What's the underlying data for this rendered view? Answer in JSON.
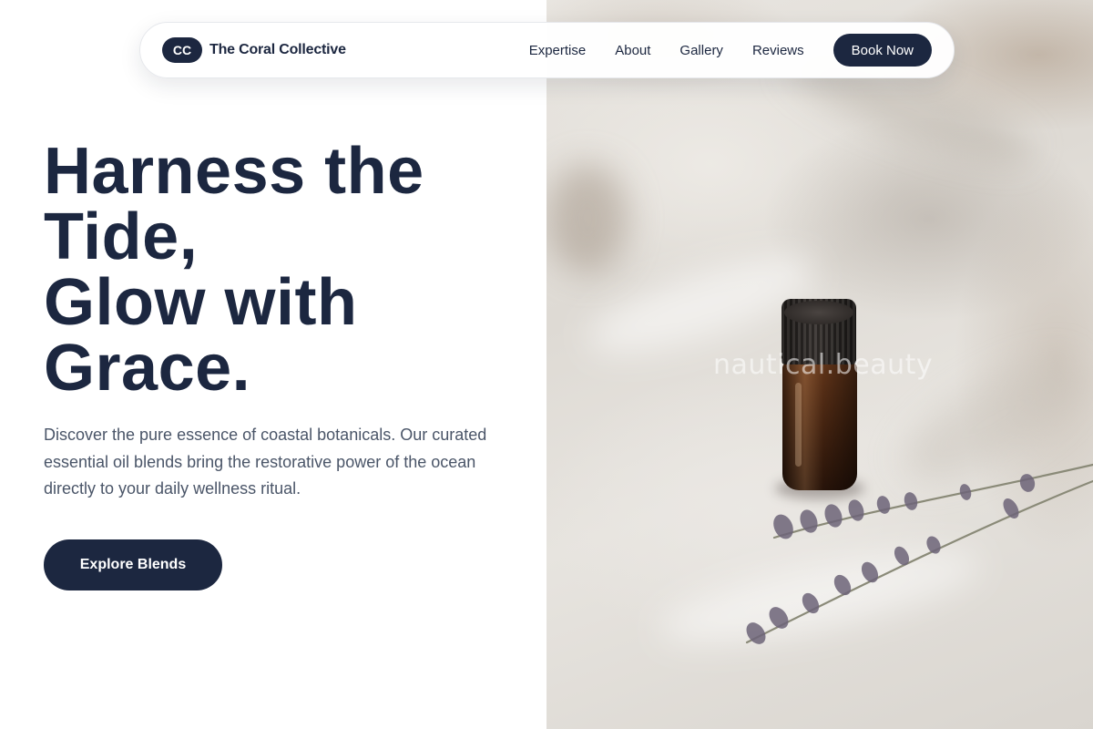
{
  "brand": {
    "badge": "CC",
    "name": "The Coral Collective"
  },
  "nav": {
    "links": [
      "Expertise",
      "About",
      "Gallery",
      "Reviews"
    ],
    "cta_label": "Book Now"
  },
  "hero": {
    "title_lines": [
      "Harness the",
      "Tide,",
      "Glow with",
      "Grace."
    ],
    "description": "Discover the pure essence of coastal botanicals. Our curated essential oil blends bring the restorative power of the ocean directly to your daily wellness ritual.",
    "cta_label": "Explore Blends"
  },
  "image": {
    "watermark": "nautical.beauty",
    "subject_icons": [
      "essential-oil-bottle",
      "lavender-sprig",
      "linen-cloth"
    ]
  },
  "colors": {
    "primary": "#1c2740",
    "body_text": "#4a5568",
    "background": "#ffffff"
  }
}
